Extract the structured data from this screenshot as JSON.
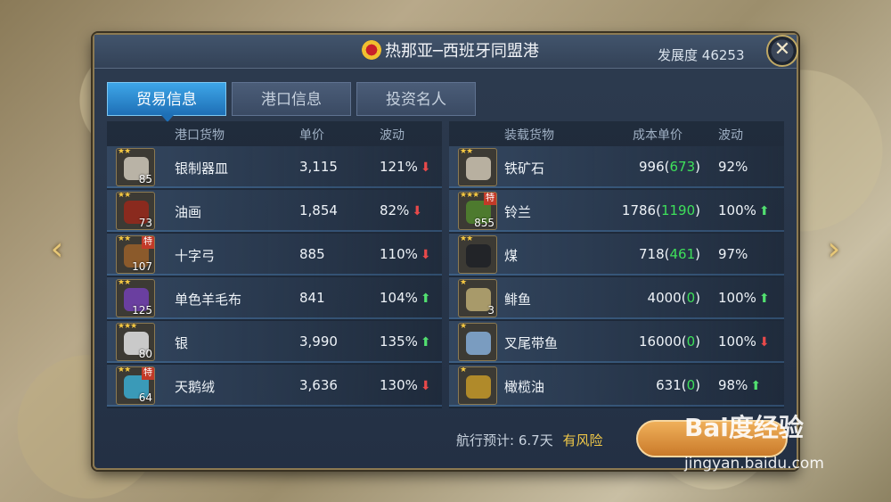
{
  "window": {
    "title": "热那亚─西班牙同盟港",
    "dev_label": "发展度",
    "dev_value": "46253",
    "close_label": "✕"
  },
  "nav": {
    "left_icon": "chevron-left-icon",
    "right_icon": "chevron-right-icon"
  },
  "tabs": [
    {
      "label": "贸易信息",
      "active": true
    },
    {
      "label": "港口信息",
      "active": false
    },
    {
      "label": "投资名人",
      "active": false
    }
  ],
  "left_table": {
    "headers": {
      "goods": "港口货物",
      "price": "单价",
      "fluct": "波动"
    },
    "rows": [
      {
        "name": "银制器皿",
        "qty": "85",
        "stars": "★★",
        "special": "",
        "price": "3,115",
        "fluct": "121%",
        "trend": "down"
      },
      {
        "name": "油画",
        "qty": "73",
        "stars": "★★",
        "special": "",
        "price": "1,854",
        "fluct": "82%",
        "trend": "down"
      },
      {
        "name": "十字弓",
        "qty": "107",
        "stars": "★★",
        "special": "特",
        "price": "885",
        "fluct": "110%",
        "trend": "down"
      },
      {
        "name": "单色羊毛布",
        "qty": "125",
        "stars": "★★",
        "special": "",
        "price": "841",
        "fluct": "104%",
        "trend": "up"
      },
      {
        "name": "银",
        "qty": "80",
        "stars": "★★★",
        "special": "",
        "price": "3,990",
        "fluct": "135%",
        "trend": "up"
      },
      {
        "name": "天鹅绒",
        "qty": "64",
        "stars": "★★",
        "special": "特",
        "price": "3,636",
        "fluct": "130%",
        "trend": "down"
      }
    ]
  },
  "right_table": {
    "headers": {
      "goods": "装载货物",
      "price": "成本单价",
      "fluct": "波动"
    },
    "rows": [
      {
        "name": "铁矿石",
        "qty": "",
        "stars": "★★",
        "special": "",
        "cost": "996",
        "diff": "673",
        "fluct": "92%",
        "trend": "none"
      },
      {
        "name": "铃兰",
        "qty": "855",
        "stars": "★★★",
        "special": "特",
        "cost": "1786",
        "diff": "1190",
        "fluct": "100%",
        "trend": "up"
      },
      {
        "name": "煤",
        "qty": "",
        "stars": "★★",
        "special": "",
        "cost": "718",
        "diff": "461",
        "fluct": "97%",
        "trend": "none"
      },
      {
        "name": "鲱鱼",
        "qty": "3",
        "stars": "★",
        "special": "",
        "cost": "4000",
        "diff": "0",
        "fluct": "100%",
        "trend": "up"
      },
      {
        "name": "叉尾带鱼",
        "qty": "",
        "stars": "★",
        "special": "",
        "cost": "16000",
        "diff": "0",
        "fluct": "100%",
        "trend": "down"
      },
      {
        "name": "橄榄油",
        "qty": "",
        "stars": "★",
        "special": "",
        "cost": "631",
        "diff": "0",
        "fluct": "98%",
        "trend": "up"
      }
    ]
  },
  "footer": {
    "eta_label": "航行预计:",
    "eta_value": "6.7天",
    "risk": "有风险",
    "sail_button": ""
  },
  "watermark": {
    "logo": "Bai度经验",
    "url": "jingyan.baidu.com"
  },
  "colors": {
    "accent_blue": "#1e6fb6",
    "gold": "#bfa865",
    "green": "#3ee05a",
    "red": "#e8494a"
  }
}
